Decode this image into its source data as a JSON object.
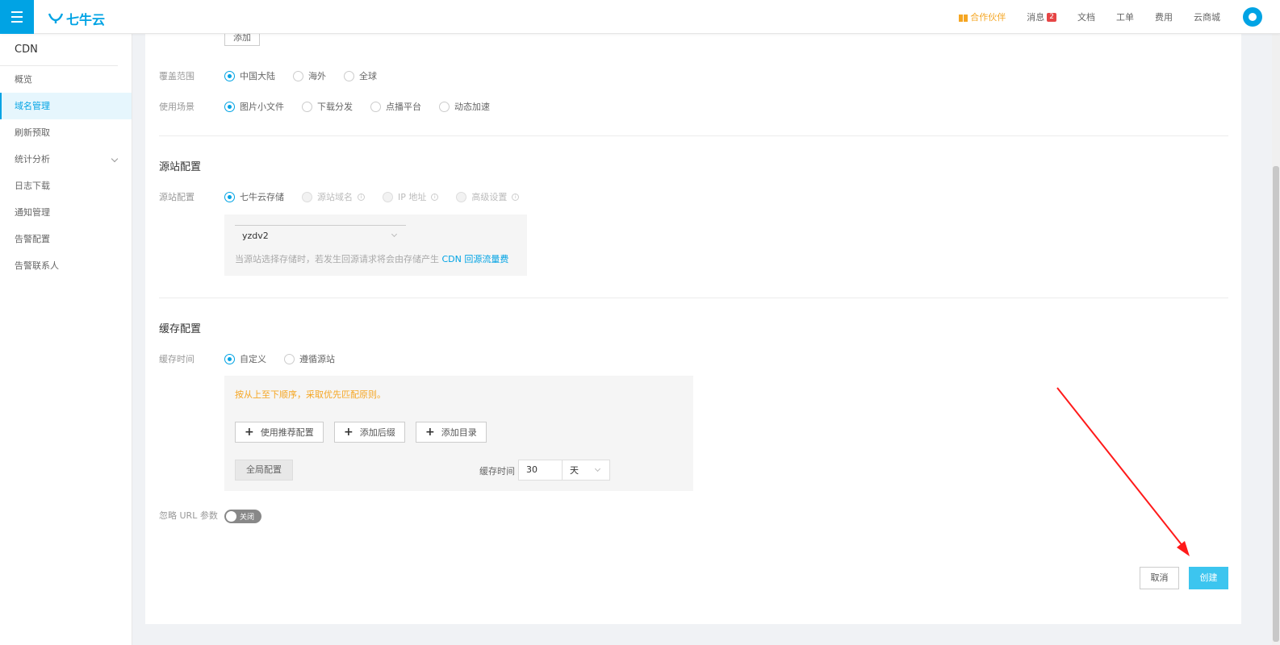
{
  "topbar": {
    "logo_text": "七牛云",
    "nav": {
      "partner": "合作伙伴",
      "messages": "消息",
      "messages_count": "2",
      "docs": "文档",
      "tickets": "工单",
      "billing": "费用",
      "store": "云商城"
    }
  },
  "sidebar": {
    "title": "CDN",
    "items": [
      {
        "label": "概览"
      },
      {
        "label": "域名管理"
      },
      {
        "label": "刷新预取"
      },
      {
        "label": "统计分析"
      },
      {
        "label": "日志下载"
      },
      {
        "label": "通知管理"
      },
      {
        "label": "告警配置"
      },
      {
        "label": "告警联系人"
      }
    ]
  },
  "form": {
    "add_button": "添加",
    "coverage": {
      "label": "覆盖范围",
      "options": [
        "中国大陆",
        "海外",
        "全球"
      ],
      "selected": "中国大陆"
    },
    "scenario": {
      "label": "使用场景",
      "options": [
        "图片小文件",
        "下载分发",
        "点播平台",
        "动态加速"
      ],
      "selected": "图片小文件"
    },
    "origin_section": {
      "title": "源站配置",
      "label": "源站配置",
      "options": [
        "七牛云存储",
        "源站域名",
        "IP 地址",
        "高级设置"
      ],
      "info_mark": "i",
      "selected": "七牛云存储",
      "bucket_value": "yzdv2",
      "note_prefix": "当源站选择存储时，若发生回源请求将会由存储产生",
      "note_link": "CDN 回源流量费"
    },
    "cache_section": {
      "title": "缓存配置",
      "label": "缓存时间",
      "options": [
        "自定义",
        "遵循源站"
      ],
      "selected": "自定义",
      "warning": "按从上至下顺序，采取优先匹配原则。",
      "buttons": {
        "recommended": "使用推荐配置",
        "add_suffix": "添加后缀",
        "add_dir": "添加目录"
      },
      "plus_glyph": "+",
      "global_config": "全局配置",
      "cache_time_label": "缓存时间",
      "cache_time_value": "30",
      "cache_unit": "天"
    },
    "ignore_params": {
      "label": "忽略 URL 参数",
      "toggle_text": "关闭"
    },
    "actions": {
      "cancel": "取消",
      "create": "创建"
    }
  }
}
